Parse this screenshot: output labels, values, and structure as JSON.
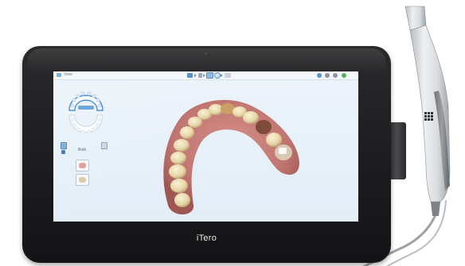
{
  "device": {
    "brand": "iTero"
  },
  "screen": {
    "topbar": {
      "view_label": "View"
    },
    "left_panel": {
      "arch_selector_label": "Both"
    }
  },
  "colors": {
    "accent": "#4c8fd0",
    "status_green": "#52b254",
    "screen_background": "#e6eff8",
    "device_frame": "#1d1d1f"
  },
  "icons": {
    "top_left": "view-icon",
    "top_center": [
      "folder-icon",
      "document-icon",
      "scan-icon",
      "zoom-icon",
      "image-icon"
    ],
    "top_right": [
      "info-icon",
      "eye-icon",
      "settings-icon",
      "help-icon"
    ],
    "left_tools": [
      "gum-tool-icon",
      "tooth-tool-icon"
    ]
  }
}
